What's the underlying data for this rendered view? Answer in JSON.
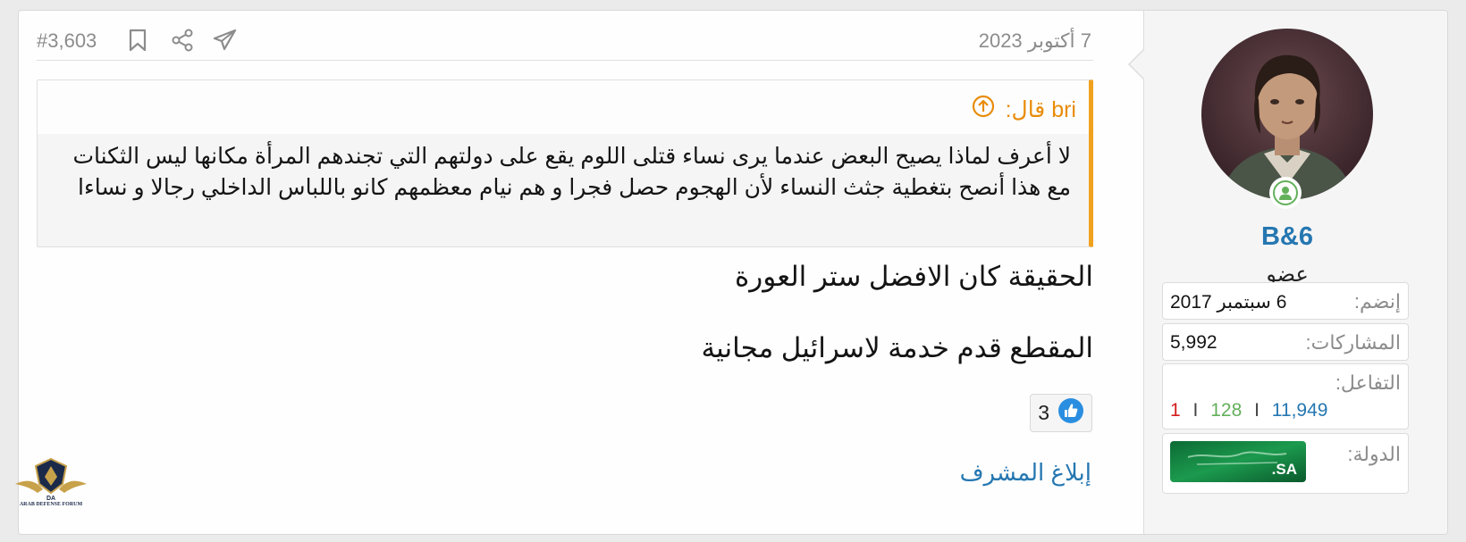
{
  "post": {
    "date": "7 أكتوبر 2023",
    "number": "#3,603"
  },
  "header_icons": [
    "bookmark-icon",
    "share-icon",
    "send-icon"
  ],
  "quote": {
    "attribution": "bri قال:",
    "text": "لا أعرف لماذا يصيح البعض عندما يرى نساء قتلى اللوم يقع على دولتهم التي تجندهم المرأة مكانها ليس الثكنات مع هذا أنصح بتغطية جثث النساء لأن الهجوم حصل فجرا و هم نيام معظمهم كانو باللباس الداخلي رجالا و نساءا"
  },
  "message": {
    "line1": "الحقيقة كان الافضل ستر العورة",
    "line2": "المقطع قدم خدمة لاسرائيل مجانية"
  },
  "reactions": {
    "count": "3",
    "icon": "like-icon"
  },
  "actions": {
    "report": "إبلاغ المشرف"
  },
  "user": {
    "name": "B&6",
    "title": "عضو",
    "joined_label": "إنضم:",
    "joined_value": "6 سبتمبر 2017",
    "posts_label": "المشاركات:",
    "posts_value": "5,992",
    "reactions_label": "التفاعل:",
    "reaction_positive": "11,949",
    "reaction_neutral": "128",
    "reaction_negative": "1",
    "reaction_sep": "I",
    "country_label": "الدولة:",
    "flag_text": ".SA"
  },
  "logo": {
    "text": "ARAB DEFENSE FORUM"
  },
  "colors": {
    "accent": "#2577b1",
    "quote_border": "#f0a11e",
    "quote_text": "#e98c0a",
    "positive": "#2577b1",
    "neutral": "#63b05b",
    "negative": "#d31d1d",
    "online": "#63b05b"
  }
}
